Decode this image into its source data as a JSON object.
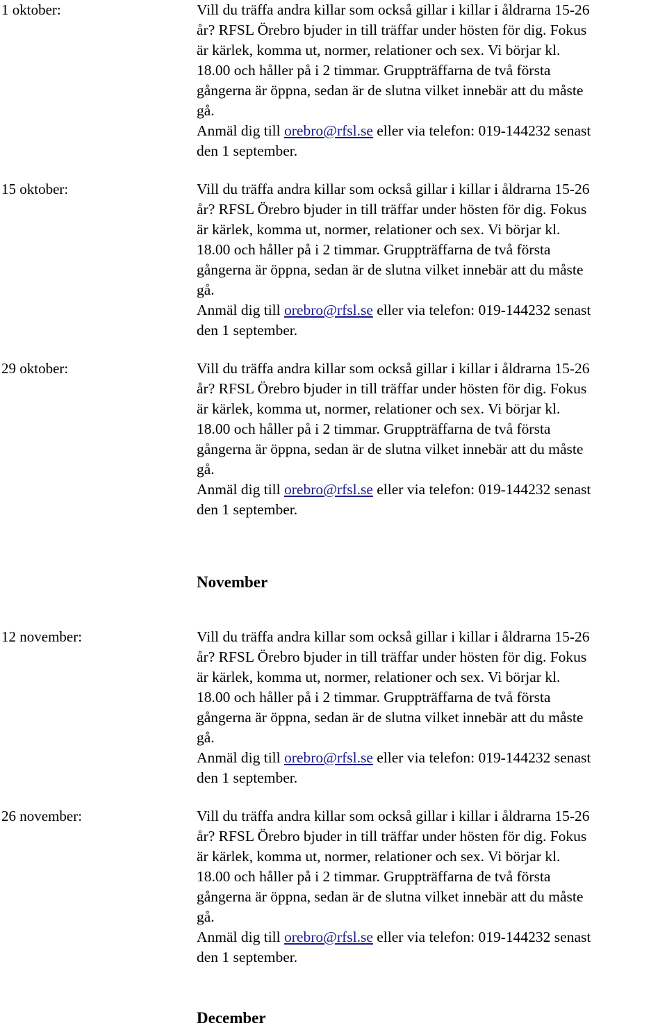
{
  "document": {
    "language": "sv",
    "link_color": "#1a1a8c",
    "text_color": "#000000",
    "background": "#ffffff"
  },
  "body_lines": [
    "Vill du träffa andra killar som också gillar i killar i åldrarna 15-26",
    "år? RFSL Örebro bjuder in till träffar under hösten för dig. Fokus",
    "är kärlek, komma ut, normer, relationer och sex. Vi börjar kl.",
    "18.00 och håller på i 2 timmar. Gruppträffarna de två första",
    "gångerna är öppna, sedan är de slutna vilket innebär att du måste",
    "gå.",
    "den 1 september."
  ],
  "signup_line": {
    "before": "Anmäl dig till ",
    "email": "orebro@rfsl.se",
    "after": " eller via telefon: 019-144232 senast"
  },
  "months": {
    "november": "November",
    "december": "December"
  },
  "events": [
    {
      "date": "1 oktober:"
    },
    {
      "date": "15 oktober:"
    },
    {
      "date": "29 oktober:"
    },
    {
      "date": "12 november:"
    },
    {
      "date": "26 november:"
    }
  ]
}
